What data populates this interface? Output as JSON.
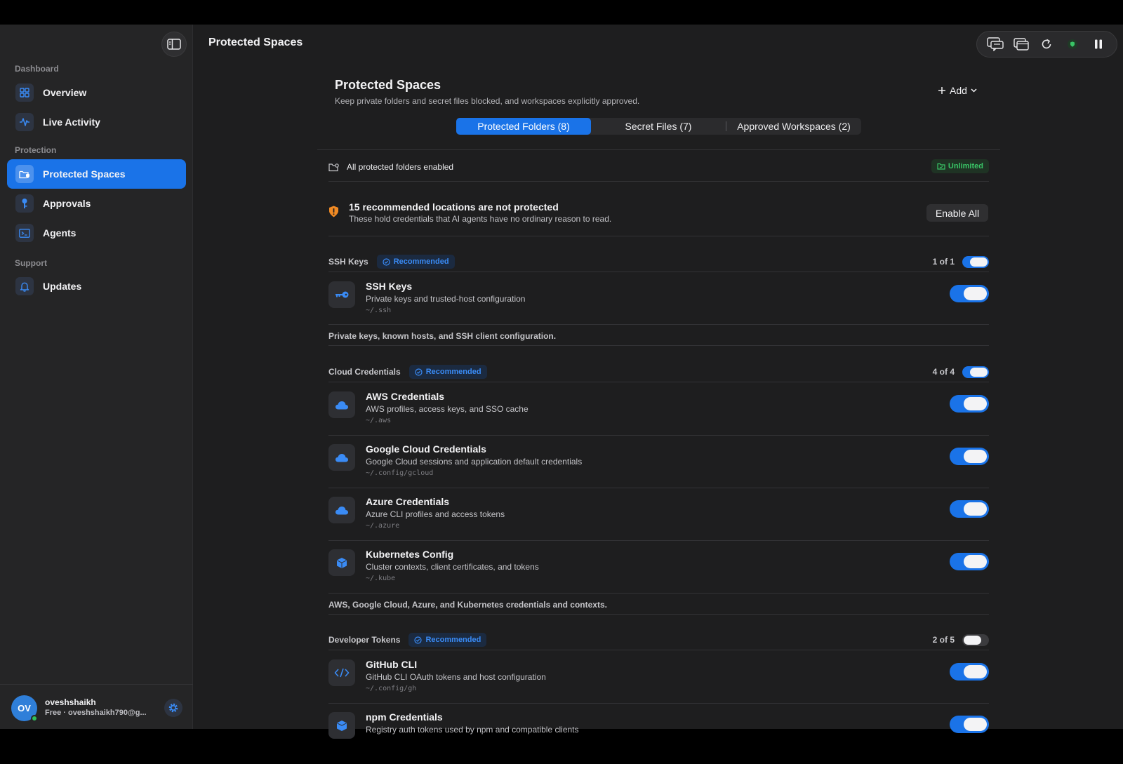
{
  "sidebar": {
    "sections": {
      "dashboard": "Dashboard",
      "protection": "Protection",
      "support": "Support"
    },
    "items": [
      {
        "label": "Overview",
        "icon": "grid-icon"
      },
      {
        "label": "Live Activity",
        "icon": "pulse-icon"
      },
      {
        "label": "Protected Spaces",
        "icon": "folder-shield-icon",
        "active": true
      },
      {
        "label": "Approvals",
        "icon": "key-icon"
      },
      {
        "label": "Agents",
        "icon": "terminal-icon"
      },
      {
        "label": "Updates",
        "icon": "bell-icon"
      }
    ],
    "user": {
      "initials": "OV",
      "name": "oveshshaikh",
      "subtitle": "Free · oveshshaikh790@g..."
    }
  },
  "header": {
    "title": "Protected Spaces",
    "toolbar": [
      "chat-icon",
      "windows-icon",
      "refresh-icon",
      "shield-status-icon",
      "pause-icon"
    ]
  },
  "main": {
    "title": "Protected Spaces",
    "subtitle": "Keep private folders and secret files blocked, and workspaces explicitly approved.",
    "add_label": "Add",
    "tabs": [
      {
        "label": "Protected Folders (8)",
        "active": true
      },
      {
        "label": "Secret Files (7)",
        "active": false
      },
      {
        "label": "Approved Workspaces (2)",
        "active": false
      }
    ],
    "status": {
      "text": "All protected folders enabled",
      "badge": "Unlimited"
    },
    "warning": {
      "title": "15 recommended locations are not protected",
      "subtitle": "These hold credentials that AI agents have no ordinary reason to read.",
      "button": "Enable All"
    },
    "groups": [
      {
        "name": "SSH Keys",
        "badge": "Recommended",
        "count": "1 of 1",
        "enabled": true,
        "items": [
          {
            "title": "SSH Keys",
            "desc": "Private keys and trusted-host configuration",
            "path": "~/.ssh",
            "icon": "key-icon",
            "enabled": true
          }
        ],
        "note": "Private keys, known hosts, and SSH client configuration."
      },
      {
        "name": "Cloud Credentials",
        "badge": "Recommended",
        "count": "4 of 4",
        "enabled": true,
        "items": [
          {
            "title": "AWS Credentials",
            "desc": "AWS profiles, access keys, and SSO cache",
            "path": "~/.aws",
            "icon": "cloud-icon",
            "enabled": true
          },
          {
            "title": "Google Cloud Credentials",
            "desc": "Google Cloud sessions and application default credentials",
            "path": "~/.config/gcloud",
            "icon": "cloud-icon",
            "enabled": true
          },
          {
            "title": "Azure Credentials",
            "desc": "Azure CLI profiles and access tokens",
            "path": "~/.azure",
            "icon": "cloud-icon",
            "enabled": true
          },
          {
            "title": "Kubernetes Config",
            "desc": "Cluster contexts, client certificates, and tokens",
            "path": "~/.kube",
            "icon": "cube-icon",
            "enabled": true
          }
        ],
        "note": "AWS, Google Cloud, Azure, and Kubernetes credentials and contexts."
      },
      {
        "name": "Developer Tokens",
        "badge": "Recommended",
        "count": "2 of 5",
        "enabled": false,
        "items": [
          {
            "title": "GitHub CLI",
            "desc": "GitHub CLI OAuth tokens and host configuration",
            "path": "~/.config/gh",
            "icon": "code-icon",
            "enabled": true
          },
          {
            "title": "npm Credentials",
            "desc": "Registry auth tokens used by npm and compatible clients",
            "path": "",
            "icon": "package-icon",
            "enabled": true
          }
        ]
      }
    ]
  },
  "colors": {
    "accent": "#1a73e8",
    "background": "#1e1e1f",
    "sidebar": "#252526",
    "success": "#39c466",
    "warning": "#f08a24"
  }
}
